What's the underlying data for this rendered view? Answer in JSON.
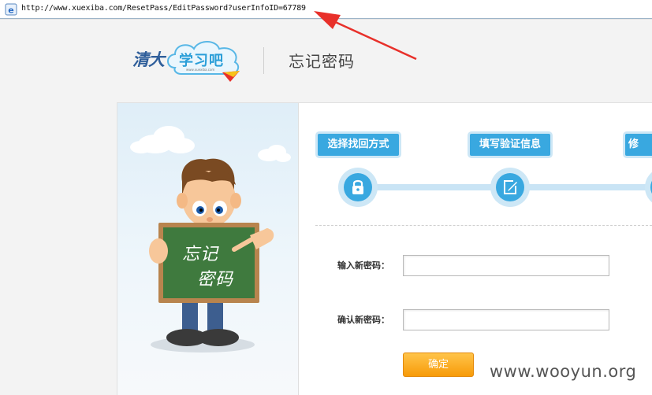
{
  "browser": {
    "url": "http://www.xuexiba.com/ResetPass/EditPassword?userInfoID=67789",
    "icon": "ie-page-icon"
  },
  "header": {
    "logo_prefix": "清大",
    "logo_text": "学习吧",
    "logo_small": "www.xuexiba.com",
    "title": "忘记密码"
  },
  "illustration": {
    "board_line1": "忘记",
    "board_line2": "密码"
  },
  "steps": [
    {
      "label": "选择找回方式",
      "icon": "lock-icon"
    },
    {
      "label": "填写验证信息",
      "icon": "edit-icon"
    },
    {
      "label": "修",
      "icon": "step3-icon"
    }
  ],
  "form": {
    "new_password_label": "输入新密码：",
    "new_password_value": "",
    "confirm_password_label": "确认新密码：",
    "confirm_password_value": "",
    "submit_label": "确定"
  },
  "watermark": "www.wooyun.org",
  "colors": {
    "step_blue": "#39a8e0",
    "button_orange": "#f7a31b",
    "arrow_red": "#e8302a"
  }
}
